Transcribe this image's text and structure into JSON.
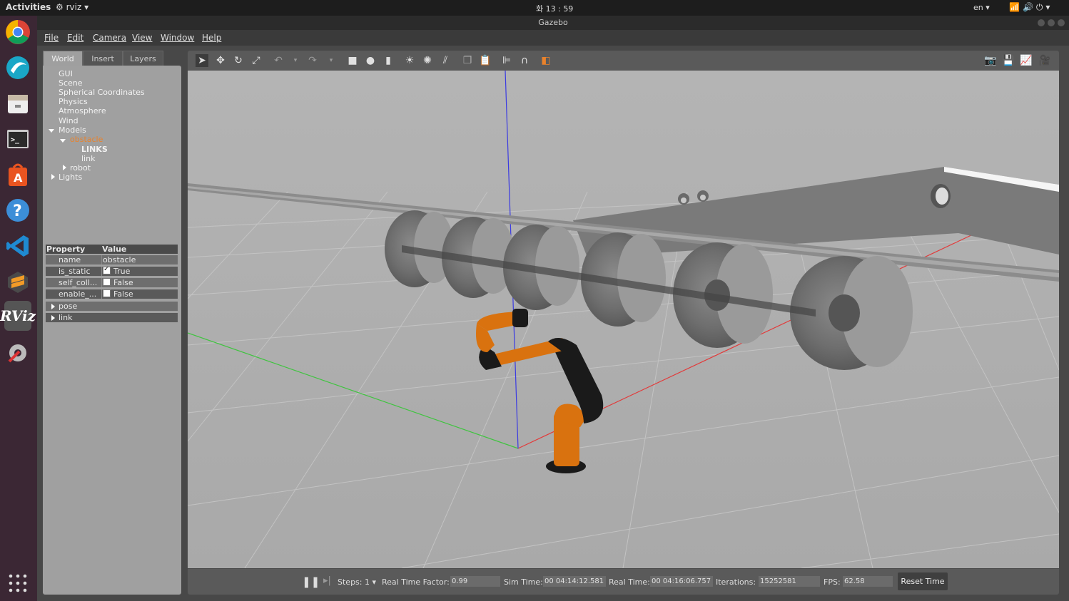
{
  "topbar": {
    "activities": "Activities",
    "app_name": "rviz",
    "clock": "화 13 : 59",
    "language": "en"
  },
  "window": {
    "title": "Gazebo"
  },
  "menu": [
    "File",
    "Edit",
    "Camera",
    "View",
    "Window",
    "Help"
  ],
  "tabs": [
    "World",
    "Insert",
    "Layers"
  ],
  "tree": {
    "gui": "GUI",
    "scene": "Scene",
    "spherical": "Spherical Coordinates",
    "physics": "Physics",
    "atmosphere": "Atmosphere",
    "wind": "Wind",
    "models": "Models",
    "obstacle": "obstacle",
    "links_header": "LINKS",
    "link": "link",
    "robot": "robot",
    "lights": "Lights"
  },
  "properties": {
    "col_property": "Property",
    "col_value": "Value",
    "name_key": "name",
    "name_value": "obstacle",
    "static_key": "is_static",
    "static_value": "True",
    "selfcoll_key": "self_coll...",
    "selfcoll_value": "False",
    "enable_key": "enable_...",
    "enable_value": "False",
    "pose": "pose",
    "link": "link"
  },
  "bottom": {
    "steps_label": "Steps:",
    "steps_value": "1",
    "rtf_label": "Real Time Factor:",
    "rtf_value": "0.99",
    "sim_label": "Sim Time:",
    "sim_value": "00 04:14:12.581",
    "real_label": "Real Time:",
    "real_value": "00 04:16:06.757",
    "iter_label": "Iterations:",
    "iter_value": "15252581",
    "fps_label": "FPS:",
    "fps_value": "62.58",
    "reset_label": "Reset Time"
  },
  "colors": {
    "selected": "#e9822b",
    "robot_orange": "#d9720f",
    "robot_black": "#1a1a1a",
    "axis_x": "#e23a3a",
    "axis_y": "#3fc43f",
    "axis_z": "#3a3ae2"
  }
}
